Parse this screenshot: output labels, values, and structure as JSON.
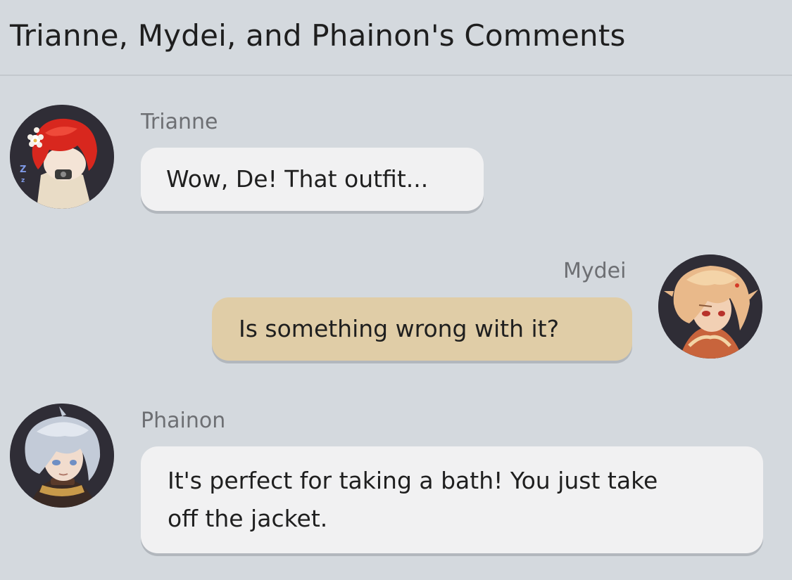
{
  "header": {
    "title": "Trianne, Mydei, and Phainon's Comments"
  },
  "messages": [
    {
      "sender": "Trianne",
      "text": "Wow, De! That outfit...",
      "side": "left",
      "bubble_color": "#f1f1f2"
    },
    {
      "sender": "Mydei",
      "text": "Is something wrong with it?",
      "side": "right",
      "bubble_color": "#e0cda7"
    },
    {
      "sender": "Phainon",
      "text_line1": "It's perfect for taking a bath! You just take",
      "text_line2": "off the jacket.",
      "side": "left",
      "bubble_color": "#f1f1f2"
    }
  ],
  "colors": {
    "background": "#d4d9de",
    "divider": "#c3c8cd",
    "name_text": "#6d6f73",
    "avatar_ring": "#2f2d36"
  }
}
